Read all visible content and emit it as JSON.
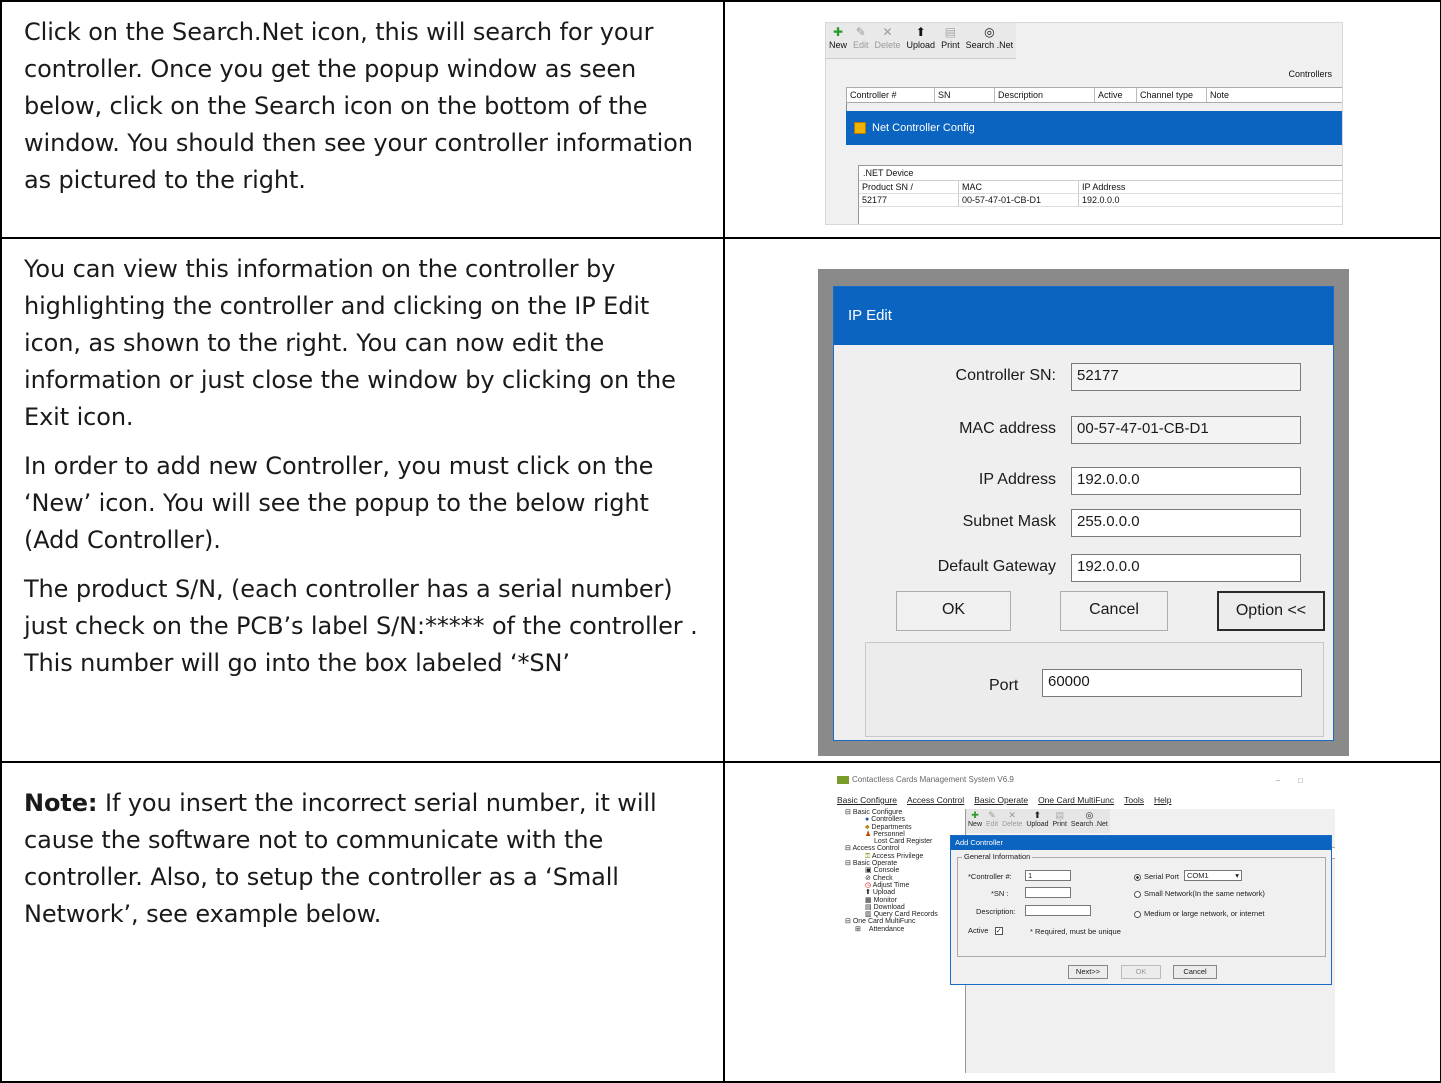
{
  "rows": [
    {
      "text": "Click on the Search.Net icon, this will search for your controller. Once you get the popup window as seen below, click on the Search icon on the bottom of the window. You should then see your controller information as pictured to the right."
    },
    {
      "paragraphs": [
        "You can view this information on the controller by highlighting the controller and clicking on the IP Edit icon, as shown to the right. You can now edit the information or just close the window by clicking on the Exit icon.",
        "In order to add new Controller, you must click on the ‘New’ icon. You will see the popup to the below right (Add Controller).",
        "The product S/N, (each controller has a serial number) just check on the PCB’s label S/N:***** of  the controller . This number will go into the box labeled ‘*SN’"
      ]
    },
    {
      "note_label": "Note:",
      "note_text": " If you insert the incorrect serial number, it will cause the software not to communicate with the controller. Also, to setup the controller as a ‘Small Network’, see example below."
    }
  ],
  "toolbar": {
    "new": "New",
    "edit": "Edit",
    "delete": "Delete",
    "upload": "Upload",
    "print": "Print",
    "search_net": "Search .Net"
  },
  "controllers_grid": {
    "title": "Controllers",
    "columns": [
      "Controller #",
      "SN",
      "Description",
      "Active",
      "Channel type",
      "Note"
    ]
  },
  "net_config": {
    "title": "Net Controller Config",
    "group_title": ".NET Device",
    "columns": [
      "Product SN /",
      "MAC",
      "IP Address"
    ],
    "row": [
      "52177",
      "00-57-47-01-CB-D1",
      "192.0.0.0"
    ]
  },
  "ip_edit": {
    "title": "IP Edit",
    "controller_sn_label": "Controller SN:",
    "controller_sn": "52177",
    "mac_label": "MAC address",
    "mac": "00-57-47-01-CB-D1",
    "ip_label": "IP Address",
    "ip": "192.0.0.0",
    "subnet_label": "Subnet Mask",
    "subnet": "255.0.0.0",
    "gateway_label": "Default Gateway",
    "gateway": "192.0.0.0",
    "ok": "OK",
    "cancel": "Cancel",
    "option": "Option <<",
    "port_label": "Port",
    "port": "60000"
  },
  "app": {
    "title": "Contactless Cards Management System  V6.9",
    "menu": [
      "Basic Configure",
      "Access Control",
      "Basic Operate",
      "One Card MultiFunc",
      "Tools",
      "Help"
    ],
    "tree": [
      {
        "label": "Basic Configure",
        "level": 0
      },
      {
        "label": "Controllers",
        "level": 1
      },
      {
        "label": "Departments",
        "level": 1
      },
      {
        "label": "Personnel",
        "level": 1
      },
      {
        "label": "Lost Card Register",
        "level": 1
      },
      {
        "label": "Access Control",
        "level": 0
      },
      {
        "label": "Access Privilege",
        "level": 1
      },
      {
        "label": "Basic Operate",
        "level": 0
      },
      {
        "label": "Console",
        "level": 1
      },
      {
        "label": "Check",
        "level": 1
      },
      {
        "label": "Adjust Time",
        "level": 1
      },
      {
        "label": "Upload",
        "level": 1
      },
      {
        "label": "Monitor",
        "level": 1
      },
      {
        "label": "Download",
        "level": 1
      },
      {
        "label": "Query Card Records",
        "level": 1
      },
      {
        "label": "One Card MultiFunc",
        "level": 0
      },
      {
        "label": "Attendance",
        "level": 1
      }
    ]
  },
  "add_controller": {
    "title": "Add Controller",
    "group": "General Information",
    "controller_label": "*Controller #:",
    "controller_value": "1",
    "sn_label": "*SN :",
    "sn_value": "",
    "desc_label": "Description:",
    "desc_value": "",
    "active_label": "Active",
    "required_note": "*  Required, must be unique",
    "serial_port": "Serial Port",
    "com_value": "COM1",
    "small_network": "Small Network(In the same network)",
    "medium_network": "Medium or large network, or internet",
    "next": "Next>>",
    "ok": "OK",
    "cancel": "Cancel"
  }
}
